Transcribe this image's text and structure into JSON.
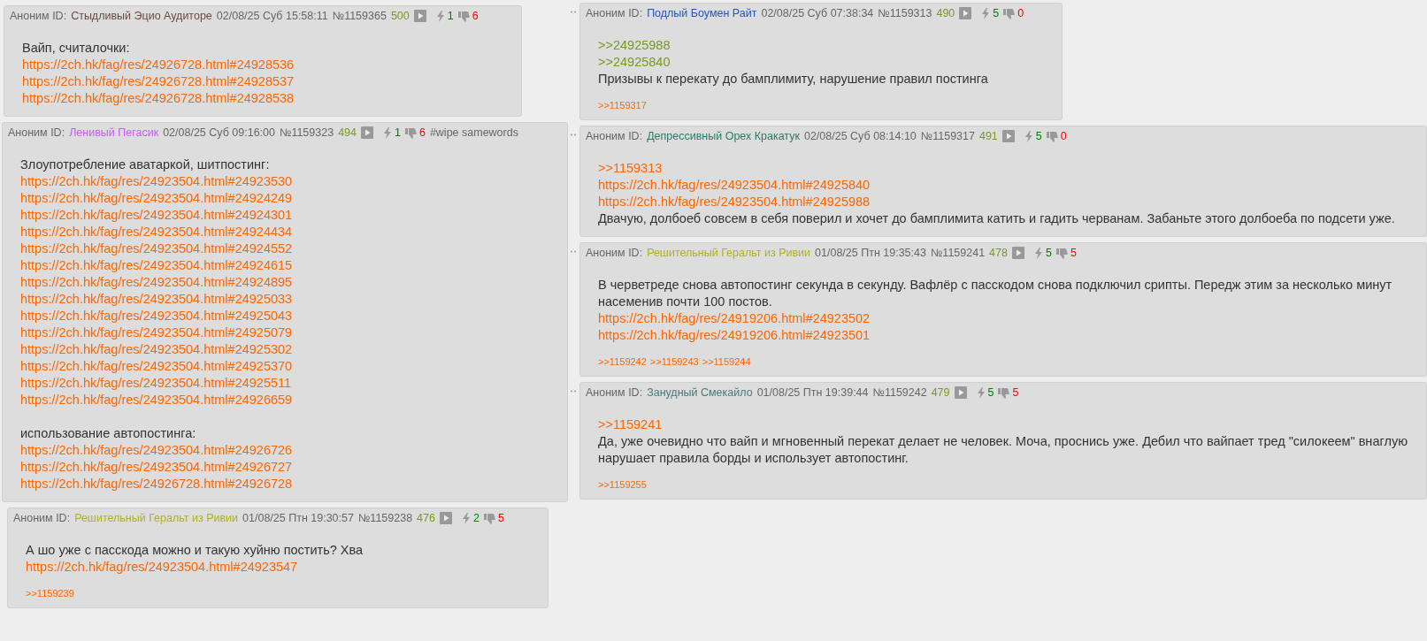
{
  "columns": [
    {
      "posts": [
        {
          "author": "Аноним ID:",
          "name": "Стыдливый Эцио Аудиторе",
          "color": "#6b4a44",
          "date": "02/08/25 Суб 15:58:11",
          "number": "№1159365",
          "count": "500",
          "likes": "1",
          "dislikes": "6",
          "paragraphs": [
            [
              {
                "kind": "text",
                "text": "Вайп, считалочки:"
              },
              {
                "kind": "link",
                "text": "https://2ch.hk/fag/res/24926728.html#24928536"
              },
              {
                "kind": "link",
                "text": "https://2ch.hk/fag/res/24926728.html#24928537"
              },
              {
                "kind": "link",
                "text": "https://2ch.hk/fag/res/24926728.html#24928538"
              }
            ]
          ]
        },
        {
          "author": "Аноним ID:",
          "name": "Ленивый Пегасик",
          "color": "#c060e8",
          "date": "02/08/25 Суб 09:16:00",
          "number": "№1159323",
          "count": "494",
          "likes": "1",
          "dislikes": "6",
          "tags": "#wipe samewords",
          "paragraphs": [
            [
              {
                "kind": "text",
                "text": "Злоупотребление аватаркой, шитпостинг:"
              },
              {
                "kind": "link",
                "text": "https://2ch.hk/fag/res/24923504.html#24923530"
              },
              {
                "kind": "link",
                "text": "https://2ch.hk/fag/res/24923504.html#24924249"
              },
              {
                "kind": "link",
                "text": "https://2ch.hk/fag/res/24923504.html#24924301"
              },
              {
                "kind": "link",
                "text": "https://2ch.hk/fag/res/24923504.html#24924434"
              },
              {
                "kind": "link",
                "text": "https://2ch.hk/fag/res/24923504.html#24924552"
              },
              {
                "kind": "link",
                "text": "https://2ch.hk/fag/res/24923504.html#24924615"
              },
              {
                "kind": "link",
                "text": "https://2ch.hk/fag/res/24923504.html#24924895"
              },
              {
                "kind": "link",
                "text": "https://2ch.hk/fag/res/24923504.html#24925033"
              },
              {
                "kind": "link",
                "text": "https://2ch.hk/fag/res/24923504.html#24925043"
              },
              {
                "kind": "link",
                "text": "https://2ch.hk/fag/res/24923504.html#24925079"
              },
              {
                "kind": "link",
                "text": "https://2ch.hk/fag/res/24923504.html#24925302"
              },
              {
                "kind": "link",
                "text": "https://2ch.hk/fag/res/24923504.html#24925370"
              },
              {
                "kind": "link",
                "text": "https://2ch.hk/fag/res/24923504.html#24925511"
              },
              {
                "kind": "link",
                "text": "https://2ch.hk/fag/res/24923504.html#24926659"
              }
            ],
            [
              {
                "kind": "text",
                "text": "использование автопостинга:"
              },
              {
                "kind": "link",
                "text": "https://2ch.hk/fag/res/24923504.html#24926726"
              },
              {
                "kind": "link",
                "text": "https://2ch.hk/fag/res/24923504.html#24926727"
              },
              {
                "kind": "link",
                "text": "https://2ch.hk/fag/res/24926728.html#24926728"
              }
            ]
          ]
        },
        {
          "author": "Аноним ID:",
          "name": "Решительный Геральт из Ривии",
          "color": "#b0b020",
          "date": "01/08/25 Птн 19:30:57",
          "number": "№1159238",
          "count": "476",
          "likes": "2",
          "dislikes": "5",
          "paragraphs": [
            [
              {
                "kind": "text",
                "text": "А шо уже с пасскода можно и такую хуйню постить? Хва"
              },
              {
                "kind": "link",
                "text": "https://2ch.hk/fag/res/24923504.html#24923547"
              }
            ]
          ],
          "replies": [
            ">>1159239"
          ]
        }
      ]
    },
    {
      "posts": [
        {
          "author": "Аноним ID:",
          "name": "Подлый Боумен Райт",
          "color": "#2255bb",
          "date": "02/08/25 Суб 07:38:34",
          "number": "№1159313",
          "count": "490",
          "likes": "5",
          "dislikes": "0",
          "paragraphs": [
            [
              {
                "kind": "quote",
                "text": ">>24925988"
              },
              {
                "kind": "quote",
                "text": ">>24925840"
              },
              {
                "kind": "text",
                "text": "Призывы к перекату до бамплимиту, нарушение правил постинга"
              }
            ]
          ],
          "replies": [
            ">>1159317"
          ]
        },
        {
          "author": "Аноним ID:",
          "name": "Депрессивный Орех Кракатук",
          "color": "#2a7a6a",
          "date": "02/08/25 Суб 08:14:10",
          "number": "№1159317",
          "count": "491",
          "likes": "5",
          "dislikes": "0",
          "paragraphs": [
            [
              {
                "kind": "reflink",
                "text": ">>1159313"
              },
              {
                "kind": "link",
                "text": "https://2ch.hk/fag/res/24923504.html#24925840"
              },
              {
                "kind": "link",
                "text": "https://2ch.hk/fag/res/24923504.html#24925988"
              },
              {
                "kind": "text",
                "text": "Двачую, долбоеб совсем в себя поверил и хочет до бамплимита катить и гадить черванам. Забаньте этого долбоеба по подсети уже."
              }
            ]
          ]
        },
        {
          "author": "Аноним ID:",
          "name": "Решительный Геральт из Ривии",
          "color": "#b0b020",
          "date": "01/08/25 Птн 19:35:43",
          "number": "№1159241",
          "count": "478",
          "likes": "5",
          "dislikes": "5",
          "paragraphs": [
            [
              {
                "kind": "text",
                "text": "В черветреде снова автопостинг секунда в секунду. Вафлёр с пасскодом снова подключил срипты. Передж этим за несколько минут насеменив почти 100 постов."
              },
              {
                "kind": "link",
                "text": "https://2ch.hk/fag/res/24919206.html#24923502"
              },
              {
                "kind": "link",
                "text": "https://2ch.hk/fag/res/24919206.html#24923501"
              }
            ]
          ],
          "replies": [
            ">>1159242",
            ">>1159243",
            ">>1159244"
          ]
        },
        {
          "author": "Аноним ID:",
          "name": "Занудный Смекайло",
          "color": "#4a7a78",
          "date": "01/08/25 Птн 19:39:44",
          "number": "№1159242",
          "count": "479",
          "likes": "5",
          "dislikes": "5",
          "paragraphs": [
            [
              {
                "kind": "reflink",
                "text": ">>1159241"
              },
              {
                "kind": "text",
                "text": "Да, уже очевидно что вайп и мгновенный перекат делает не человек. Моча, проснись уже. Дебил что вайпает тред \"силокеем\" внаглую нарушает правила борды и использует автопостинг."
              }
            ]
          ],
          "replies": [
            ">>1159255"
          ]
        }
      ]
    }
  ]
}
